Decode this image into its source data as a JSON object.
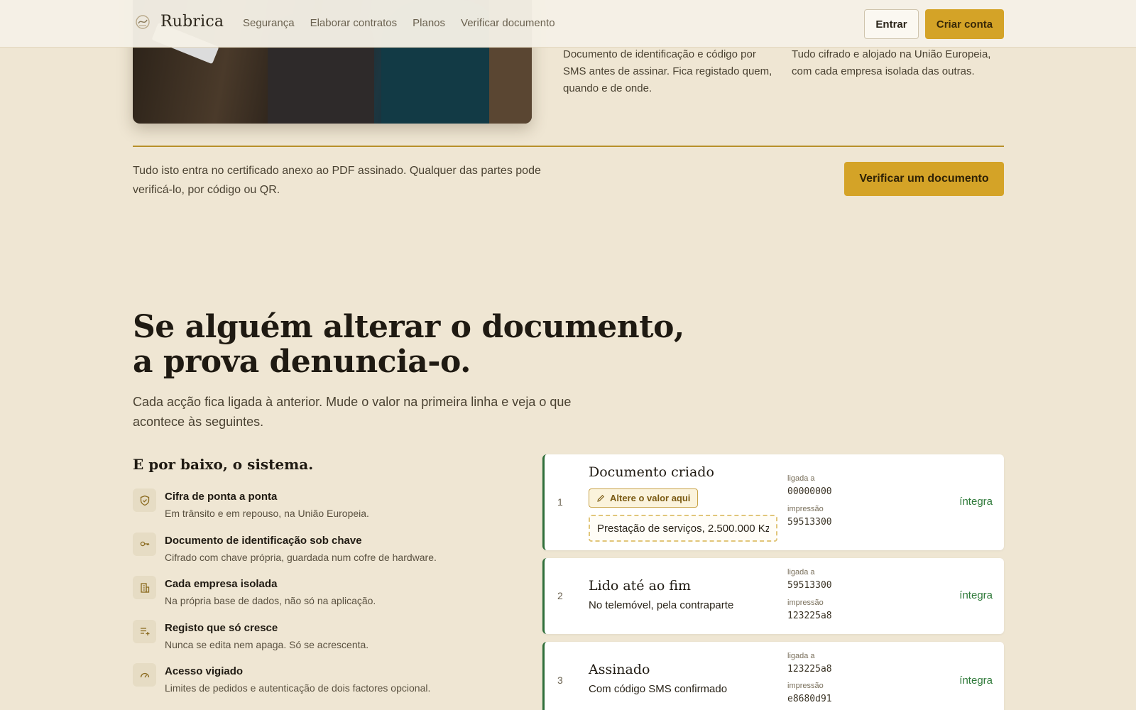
{
  "header": {
    "brand": "Rubrica",
    "nav": [
      "Segurança",
      "Elaborar contratos",
      "Planos",
      "Verificar documento"
    ],
    "login_label": "Entrar",
    "signup_label": "Criar conta"
  },
  "features": {
    "identity_text": "Documento de identificação e código por SMS antes de assinar. Fica registado quem, quando e de onde.",
    "storage_text": "Tudo cifrado e alojado na União Europeia, com cada empresa isolada das outras."
  },
  "certificate": {
    "text": "Tudo isto entra no certificado anexo ao PDF assinado. Qualquer das partes pode verificá-lo, por código ou QR.",
    "verify_button": "Verificar um documento"
  },
  "section": {
    "heading": "Se alguém alterar o documento, a prova denuncia-o.",
    "subheading": "Cada acção fica ligada à anterior. Mude o valor na primeira linha e veja o que acontece às seguintes."
  },
  "system": {
    "title": "E por baixo, o sistema.",
    "items": [
      {
        "label": "Cifra de ponta a ponta",
        "desc": "Em trânsito e em repouso, na União Europeia.",
        "icon": "shield-icon"
      },
      {
        "label": "Documento de identificação sob chave",
        "desc": "Cifrado com chave própria, guardada num cofre de hardware.",
        "icon": "key-icon"
      },
      {
        "label": "Cada empresa isolada",
        "desc": "Na própria base de dados, não só na aplicação.",
        "icon": "building-icon"
      },
      {
        "label": "Registo que só cresce",
        "desc": "Nunca se edita nem apaga. Só se acrescenta.",
        "icon": "list-add-icon"
      },
      {
        "label": "Acesso vigiado",
        "desc": "Limites de pedidos e autenticação de dois factores opcional.",
        "icon": "gauge-icon"
      }
    ]
  },
  "chain": {
    "linked_label": "ligada a",
    "print_label": "impressão",
    "edit_label": "Altere o valor aqui",
    "input_value": "Prestação de serviços, 2.500.000 Kz",
    "rows": [
      {
        "num": "1",
        "title": "Documento criado",
        "linked": "00000000",
        "print": "59513300",
        "status": "íntegra"
      },
      {
        "num": "2",
        "title": "Lido até ao fim",
        "sub": "No telemóvel, pela contraparte",
        "linked": "59513300",
        "print": "123225a8",
        "status": "íntegra"
      },
      {
        "num": "3",
        "title": "Assinado",
        "sub": "Com código SMS confirmado",
        "linked": "123225a8",
        "print": "e8680d91",
        "status": "íntegra"
      }
    ]
  },
  "colors": {
    "background": "#efe6d3",
    "accent": "#d4a327",
    "valid": "#2f7a3a"
  }
}
